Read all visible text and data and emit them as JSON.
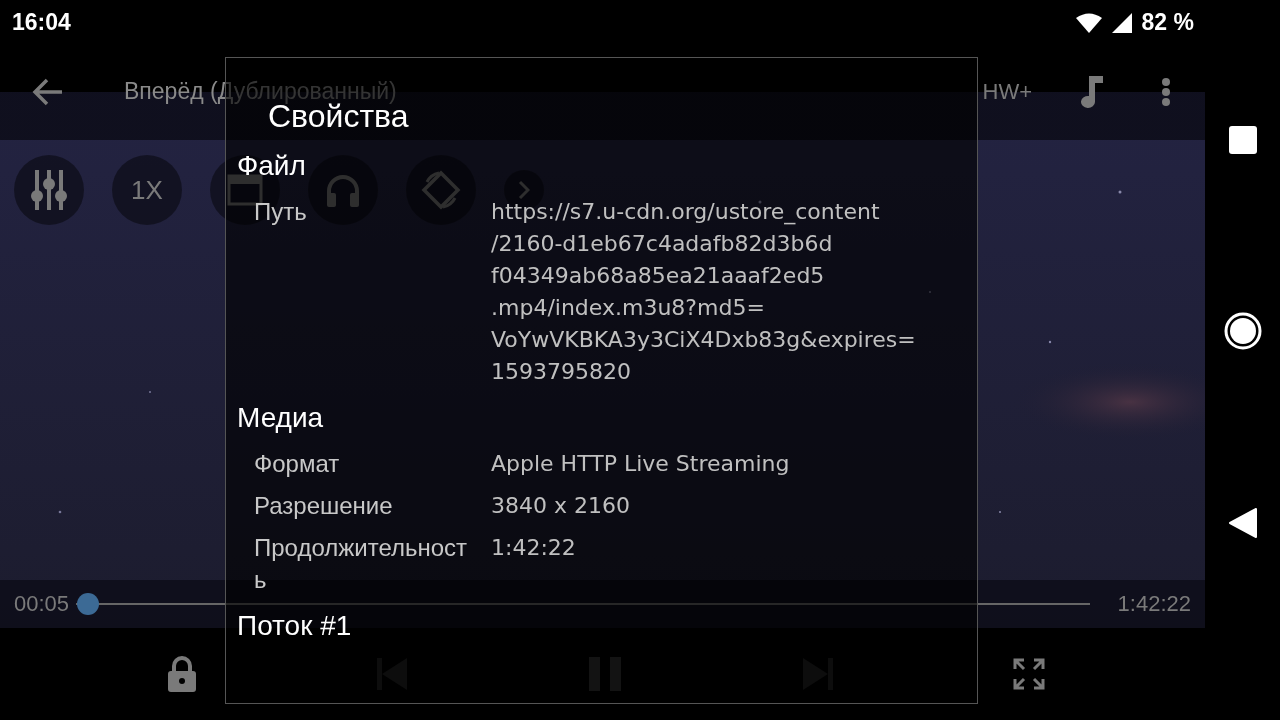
{
  "status_bar": {
    "time": "16:04",
    "battery": "82 %"
  },
  "player": {
    "title": "Вперёд (Дублированный)",
    "decoder": "HW+",
    "speed": "1X",
    "elapsed": "00:05",
    "duration": "1:42:22",
    "progress": {
      "level": 0.001
    },
    "playing": true
  },
  "dialog": {
    "title": "Свойства",
    "sections": [
      {
        "heading": "Файл",
        "rows": [
          {
            "label": "Путь",
            "value": "https://s7.u-cdn.org/ustore_content\n/2160-d1eb67c4adafb82d3b6d\nf04349ab68a85ea21aaaf2ed5\n.mp4/index.m3u8?md5=\nVoYwVKBKA3y3CiX4Dxb83g&expires=\n1593795820"
          }
        ]
      },
      {
        "heading": "Медиа",
        "rows": [
          {
            "label": "Формат",
            "value": "Apple HTTP Live Streaming"
          },
          {
            "label": "Разрешение",
            "value": "3840 x 2160"
          },
          {
            "label": "Продолжительность",
            "value": "1:42:22"
          }
        ]
      },
      {
        "heading": "Поток #1"
      }
    ]
  }
}
